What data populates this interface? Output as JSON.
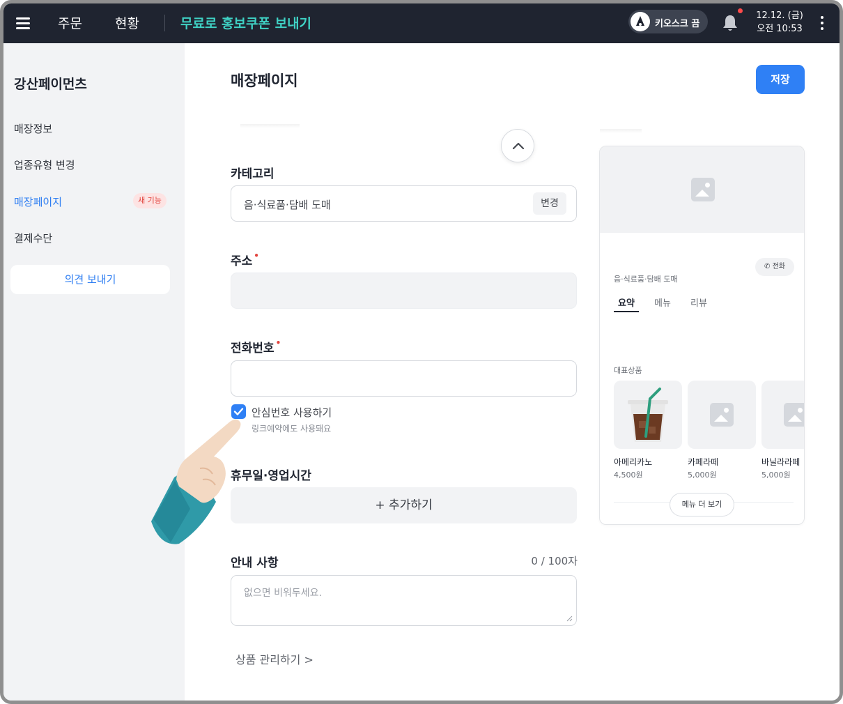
{
  "topbar": {
    "nav": [
      "주문",
      "현황"
    ],
    "promo_link": "무료로 홍보쿠폰 보내기",
    "kiosk_toggle": "키오스크 끔",
    "date": "12.12. (금)",
    "time": "오전 10:53",
    "accent_color": "#3fd1c4"
  },
  "sidebar": {
    "store_name": "강산페이먼츠",
    "items": [
      {
        "label": "매장정보"
      },
      {
        "label": "업종유형 변경"
      },
      {
        "label": "매장페이지",
        "badge": "새 기능"
      },
      {
        "label": "결제수단"
      }
    ],
    "feedback_button": "의견 보내기"
  },
  "main": {
    "page_title": "매장페이지",
    "save_button": "저장",
    "category": {
      "label": "카테고리",
      "value": "음·식료품·담배 도매",
      "change_button": "변경"
    },
    "address": {
      "label": "주소",
      "value": ""
    },
    "phone": {
      "label": "전화번호",
      "value": "",
      "safe_number_checkbox": "안심번호 사용하기",
      "safe_number_checked": true,
      "safe_number_hint": "링크예약에도 사용돼요"
    },
    "hours": {
      "label": "휴무일·영업시간",
      "add_button": "+ 추가하기"
    },
    "notice": {
      "label": "안내 사항",
      "counter": "0 / 100자",
      "placeholder": "없으면 비워두세요."
    },
    "product_link": "상품 관리하기 >"
  },
  "preview": {
    "call_button": "전화",
    "category": "음·식료품·담배 도매",
    "tabs": [
      "요약",
      "메뉴",
      "리뷰"
    ],
    "section_title": "대표상품",
    "products": [
      {
        "name": "아메리카노",
        "price": "4,500원"
      },
      {
        "name": "카페라떼",
        "price": "5,000원"
      },
      {
        "name": "바닐라라떼",
        "price": "5,000원"
      }
    ],
    "more_button": "메뉴 더 보기"
  }
}
